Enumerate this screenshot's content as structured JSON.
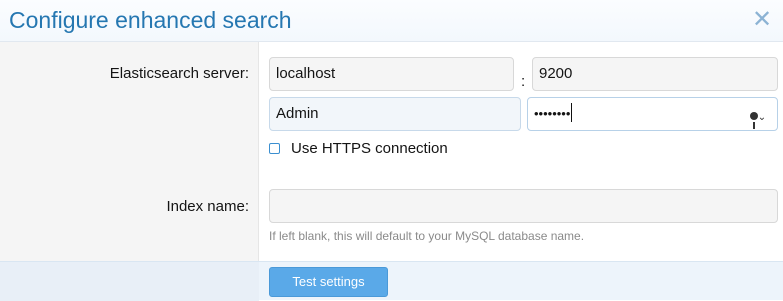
{
  "dialog": {
    "title": "Configure enhanced search",
    "close_icon": "close-icon"
  },
  "form": {
    "server_label": "Elasticsearch server:",
    "host_value": "localhost",
    "port_separator": ":",
    "port_value": "9200",
    "username_value": "Admin",
    "password_masked": "••••••••",
    "password_key_icon": "key-icon",
    "https_label": "Use HTTPS connection",
    "https_checked": false,
    "index_label": "Index name:",
    "index_value": "",
    "index_hint": "If left blank, this will default to your MySQL database name."
  },
  "footer": {
    "test_button_label": "Test settings"
  },
  "colors": {
    "title": "#2577b1",
    "button": "#5aa9e8",
    "checkbox_border": "#3b8fd0"
  }
}
